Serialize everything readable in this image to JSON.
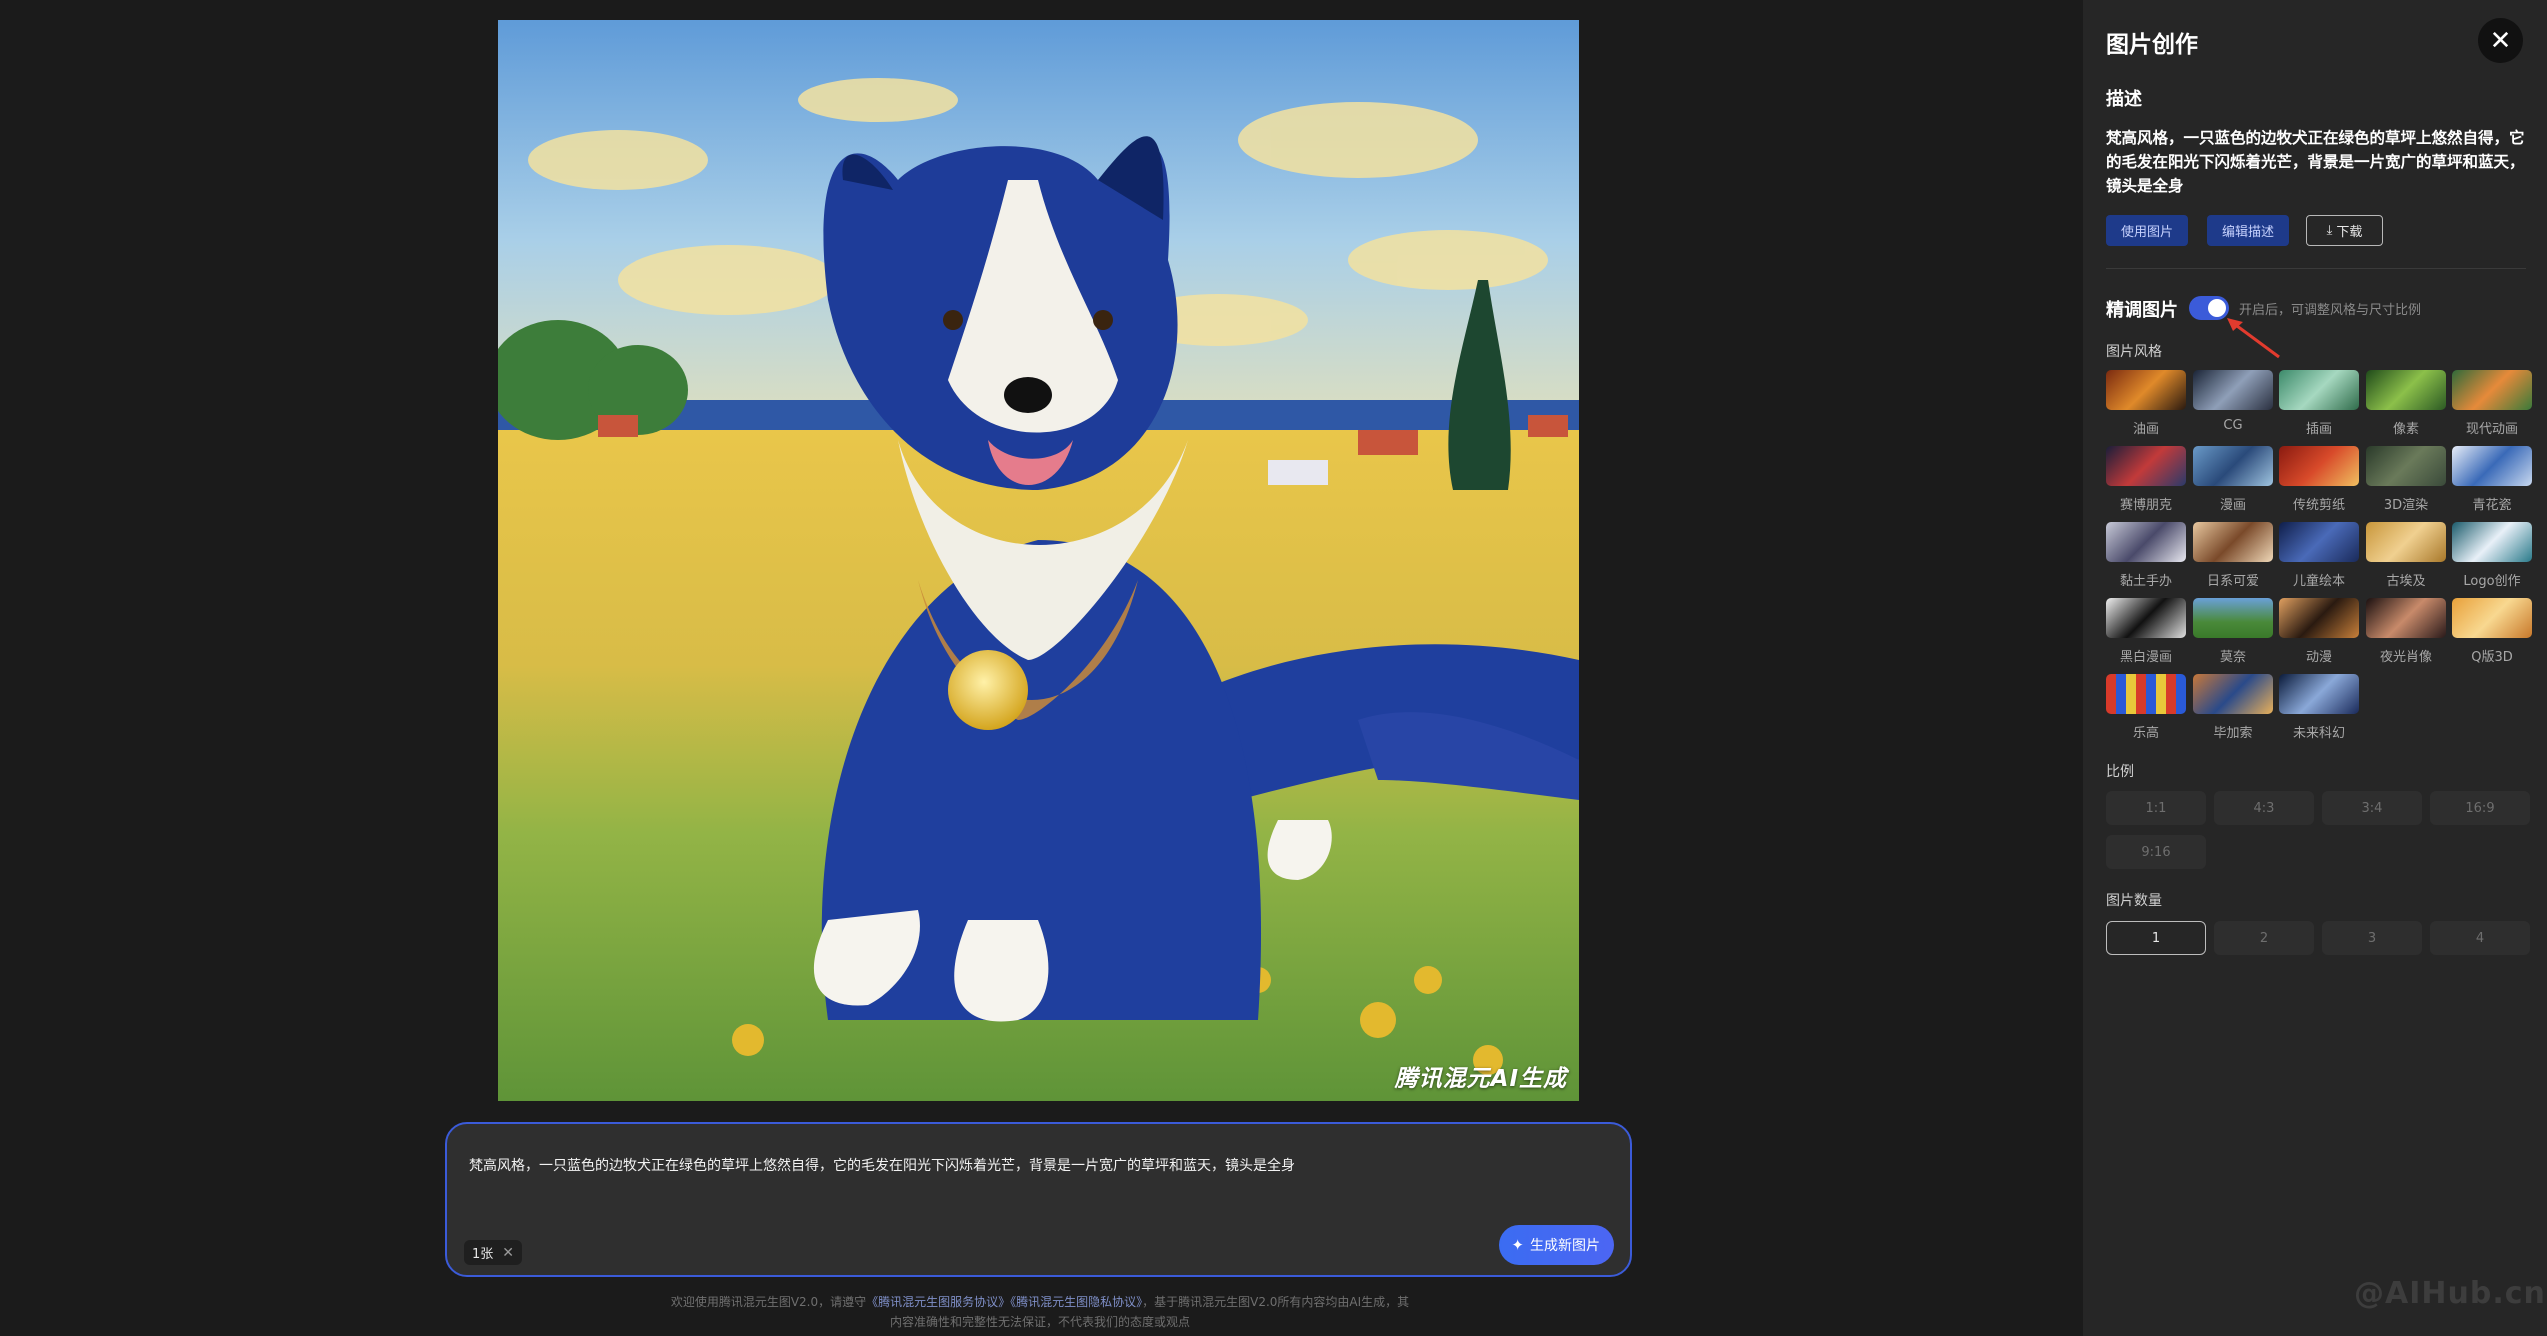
{
  "artwork": {
    "watermark": "腾讯混元AI生成"
  },
  "prompt": {
    "text": "梵高风格，一只蓝色的边牧犬正在绿色的草坪上悠然自得，它的毛发在阳光下闪烁着光芒，背景是一片宽广的草坪和蓝天，镜头是全身",
    "count_chip": "1张",
    "generate_label": "生成新图片"
  },
  "footer": {
    "pre": "欢迎使用腾讯混元生图V2.0，请遵守",
    "link1": "《腾讯混元生图服务协议》",
    "link2": "《腾讯混元生图隐私协议》",
    "post": "，基于腾讯混元生图V2.0所有内容均由AI生成，其",
    "line2": "内容准确性和完整性无法保证，不代表我们的态度或观点"
  },
  "panel": {
    "title": "图片创作",
    "desc_title": "描述",
    "desc_text": "梵高风格，一只蓝色的边牧犬正在绿色的草坪上悠然自得，它的毛发在阳光下闪烁着光芒，背景是一片宽广的草坪和蓝天，镜头是全身",
    "actions": {
      "use": "使用图片",
      "edit": "编辑描述",
      "download": "下载"
    },
    "refine_title": "精调图片",
    "refine_on": true,
    "refine_hint": "开启后，可调整风格与尺寸比例",
    "style_label": "图片风格",
    "styles": [
      "油画",
      "CG",
      "插画",
      "像素",
      "现代动画",
      "赛博朋克",
      "漫画",
      "传统剪纸",
      "3D渲染",
      "青花瓷",
      "黏土手办",
      "日系可爱",
      "儿童绘本",
      "古埃及",
      "Logo创作",
      "黑白漫画",
      "莫奈",
      "动漫",
      "夜光肖像",
      "Q版3D",
      "乐高",
      "毕加索",
      "未来科幻"
    ],
    "ratio_label": "比例",
    "ratios": [
      "1:1",
      "4:3",
      "3:4",
      "16:9",
      "9:16"
    ],
    "count_label": "图片数量",
    "counts": [
      "1",
      "2",
      "3",
      "4"
    ],
    "selected_count": "1"
  },
  "brand_watermark": "@AIHub.cn"
}
